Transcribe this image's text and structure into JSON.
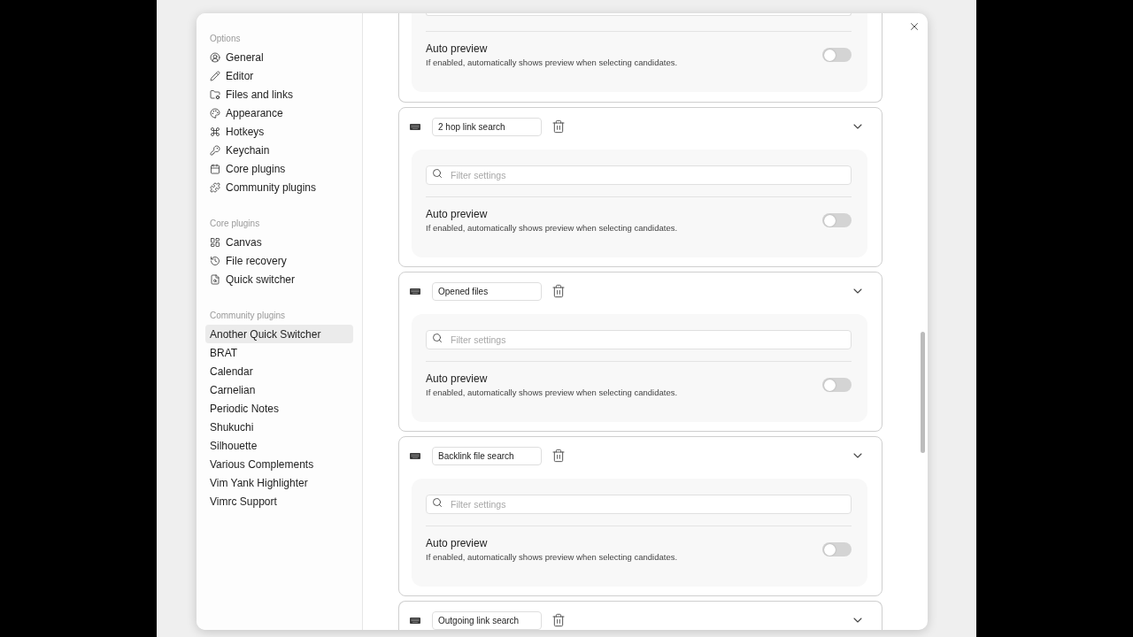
{
  "sidebar": {
    "sections": [
      {
        "title": "Options",
        "items": [
          {
            "label": "General",
            "selected": false
          },
          {
            "label": "Editor",
            "selected": false
          },
          {
            "label": "Files and links",
            "selected": false
          },
          {
            "label": "Appearance",
            "selected": false
          },
          {
            "label": "Hotkeys",
            "selected": false
          },
          {
            "label": "Keychain",
            "selected": false
          },
          {
            "label": "Core plugins",
            "selected": false
          },
          {
            "label": "Community plugins",
            "selected": false
          }
        ]
      },
      {
        "title": "Core plugins",
        "items": [
          {
            "label": "Canvas",
            "selected": false
          },
          {
            "label": "File recovery",
            "selected": false
          },
          {
            "label": "Quick switcher",
            "selected": false
          }
        ]
      },
      {
        "title": "Community plugins",
        "items": [
          {
            "label": "Another Quick Switcher",
            "selected": true
          },
          {
            "label": "BRAT",
            "selected": false
          },
          {
            "label": "Calendar",
            "selected": false
          },
          {
            "label": "Carnelian",
            "selected": false
          },
          {
            "label": "Periodic Notes",
            "selected": false
          },
          {
            "label": "Shukuchi",
            "selected": false
          },
          {
            "label": "Silhouette",
            "selected": false
          },
          {
            "label": "Various Complements",
            "selected": false
          },
          {
            "label": "Vim Yank Highlighter",
            "selected": false
          },
          {
            "label": "Vimrc Support",
            "selected": false
          }
        ]
      }
    ]
  },
  "cards": [
    {
      "setting": {
        "title": "Auto preview",
        "description": "If enabled, automatically shows preview when selecting candidates.",
        "on": false
      }
    },
    {
      "name": "2 hop link search",
      "filter_placeholder": "Filter settings",
      "setting": {
        "title": "Auto preview",
        "description": "If enabled, automatically shows preview when selecting candidates.",
        "on": false
      }
    },
    {
      "name": "Opened files",
      "filter_placeholder": "Filter settings",
      "setting": {
        "title": "Auto preview",
        "description": "If enabled, automatically shows preview when selecting candidates.",
        "on": false
      }
    },
    {
      "name": "Backlink file search",
      "filter_placeholder": "Filter settings",
      "setting": {
        "title": "Auto preview",
        "description": "If enabled, automatically shows preview when selecting candidates.",
        "on": false
      }
    },
    {
      "name": "Outgoing link search"
    }
  ]
}
